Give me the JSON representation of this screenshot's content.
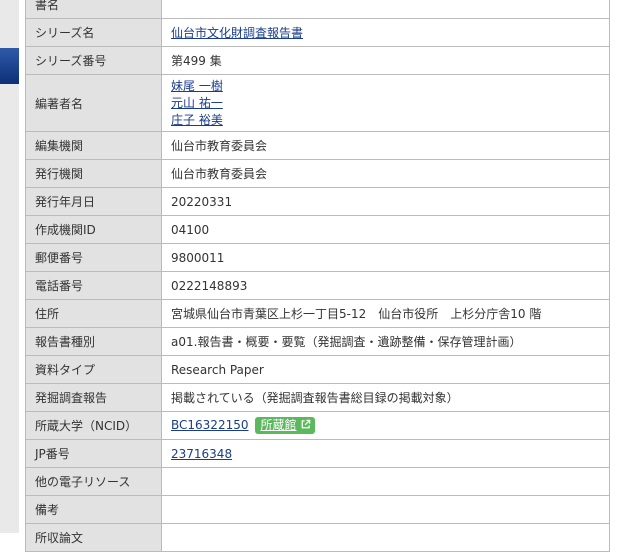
{
  "rows": [
    {
      "key": "書名",
      "value": ""
    },
    {
      "key": "シリーズ名",
      "value": "仙台市文化財調査報告書"
    },
    {
      "key": "シリーズ番号",
      "value": "第499 集"
    },
    {
      "key": "編著者名",
      "persons": [
        "妹尾 一樹",
        "元山 祐一",
        "庄子 裕美"
      ]
    },
    {
      "key": "編集機関",
      "value": "仙台市教育委員会"
    },
    {
      "key": "発行機関",
      "value": "仙台市教育委員会"
    },
    {
      "key": "発行年月日",
      "value": "20220331"
    },
    {
      "key": "作成機関ID",
      "value": "04100"
    },
    {
      "key": "郵便番号",
      "value": "9800011"
    },
    {
      "key": "電話番号",
      "value": "0222148893"
    },
    {
      "key": "住所",
      "value": "宮城県仙台市青葉区上杉一丁目5-12　仙台市役所　上杉分庁舎10 階"
    },
    {
      "key": "報告書種別",
      "value": "a01.報告書・概要・要覧（発掘調査・遺跡整備・保存管理計画）"
    },
    {
      "key": "資料タイプ",
      "value": "Research Paper"
    },
    {
      "key": "発掘調査報告",
      "value": "掲載されている（発掘調査報告書総目録の掲載対象）"
    },
    {
      "key": "所蔵大学（NCID）",
      "value": "BC16322150",
      "button": "所蔵館"
    },
    {
      "key": "JP番号",
      "value": "23716348"
    },
    {
      "key": "他の電子リソース",
      "value": ""
    },
    {
      "key": "備考",
      "value": ""
    },
    {
      "key": "所収論文",
      "value": ""
    }
  ],
  "colors": {
    "header_bg": "#e2e2e2",
    "border": "#bbbbbb",
    "link": "#1a3c8c",
    "button_bg": "#5cb85c",
    "side_tab": "#1e448f"
  },
  "icons": {
    "external": "external-link-icon"
  }
}
